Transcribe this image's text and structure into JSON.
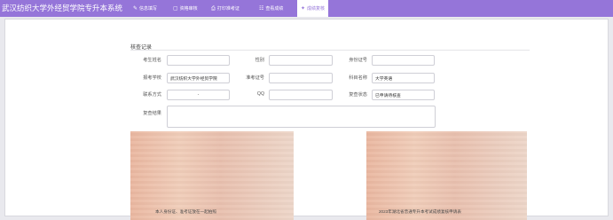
{
  "app_title": "武汉纺织大学外经贸学院专升本系统",
  "nav": [
    {
      "icon": "edit-icon",
      "glyph": "✎",
      "label": "信息填写"
    },
    {
      "icon": "review-icon",
      "glyph": "▢",
      "label": "资格审核"
    },
    {
      "icon": "print-icon",
      "glyph": "⎙",
      "label": "打印准考证"
    },
    {
      "icon": "scores-icon",
      "glyph": "☷",
      "label": "查看成绩"
    },
    {
      "icon": "recheck-icon",
      "glyph": "✦",
      "label": "成绩复核"
    }
  ],
  "section_title": "核查记录",
  "form": {
    "name": {
      "label": "考生姓名",
      "value": ""
    },
    "gender": {
      "label": "性别",
      "value": ""
    },
    "id_number": {
      "label": "身份证号",
      "value": ""
    },
    "school": {
      "label": "报考学校",
      "value": "武汉纺织大学外经贸学院"
    },
    "exam_number": {
      "label": "准考证号",
      "value": ""
    },
    "subject": {
      "label": "科目名称",
      "value": "大学英语"
    },
    "contact": {
      "label": "联系方式",
      "value": "-"
    },
    "qq": {
      "label": "QQ",
      "value": ""
    },
    "recheck_status": {
      "label": "复查状态",
      "value": "已申请待核查"
    },
    "recheck_result": {
      "label": "复查结果",
      "value": ""
    }
  },
  "captions": {
    "left": "本人身份证、准考证放在一起拍照",
    "right": "2023年湖北省普通专升本考试成绩复核申请表"
  },
  "colors": {
    "nav_bg": "#9575d9",
    "active_text": "#9575d9",
    "page_bg": "#e9e9ee"
  }
}
